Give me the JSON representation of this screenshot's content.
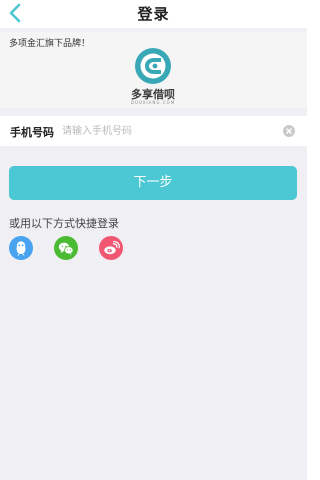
{
  "header": {
    "title": "登录",
    "back_icon": "chevron-left-icon",
    "accent_color": "#4cc8d4"
  },
  "brand": {
    "note": "多项金汇旗下品牌！",
    "logo_name": "多享借呗",
    "logo_sub": "DUOXIANG.COM",
    "logo_icon": "brand-logo-icon"
  },
  "form": {
    "phone_label": "手机号码",
    "phone_value": "",
    "phone_placeholder": "请输入手机号码",
    "clear_icon": "clear-icon",
    "next_label": "下一步"
  },
  "quick_login": {
    "label": "或用以下方式快捷登录",
    "options": [
      {
        "name": "qq",
        "icon": "qq-icon",
        "color": "#4aa3f0"
      },
      {
        "name": "wechat",
        "icon": "wechat-icon",
        "color": "#4cbb34"
      },
      {
        "name": "weibo",
        "icon": "weibo-icon",
        "color": "#f15772"
      }
    ]
  }
}
